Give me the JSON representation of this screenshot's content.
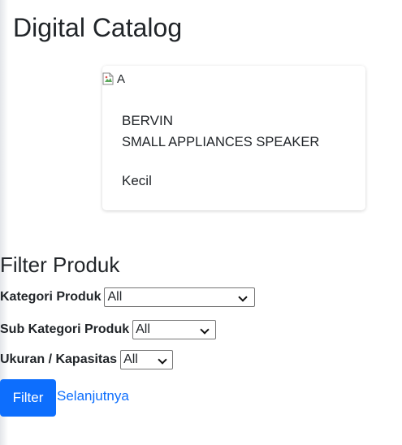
{
  "page": {
    "title": "Digital Catalog"
  },
  "product_card": {
    "image_alt": "A",
    "brand": "BERVIN",
    "name": "SMALL APPLIANCES SPEAKER",
    "size": "Kecil"
  },
  "filter": {
    "title": "Filter Produk",
    "kategori": {
      "label": "Kategori Produk",
      "selected": "All"
    },
    "sub_kategori": {
      "label": "Sub Kategori Produk",
      "selected": "All"
    },
    "ukuran": {
      "label": "Ukuran / Kapasitas",
      "selected": "All"
    },
    "filter_button": "Filter",
    "next_link": "Selanjutnya"
  },
  "colors": {
    "accent": "#0d6efd",
    "text": "#212529"
  }
}
